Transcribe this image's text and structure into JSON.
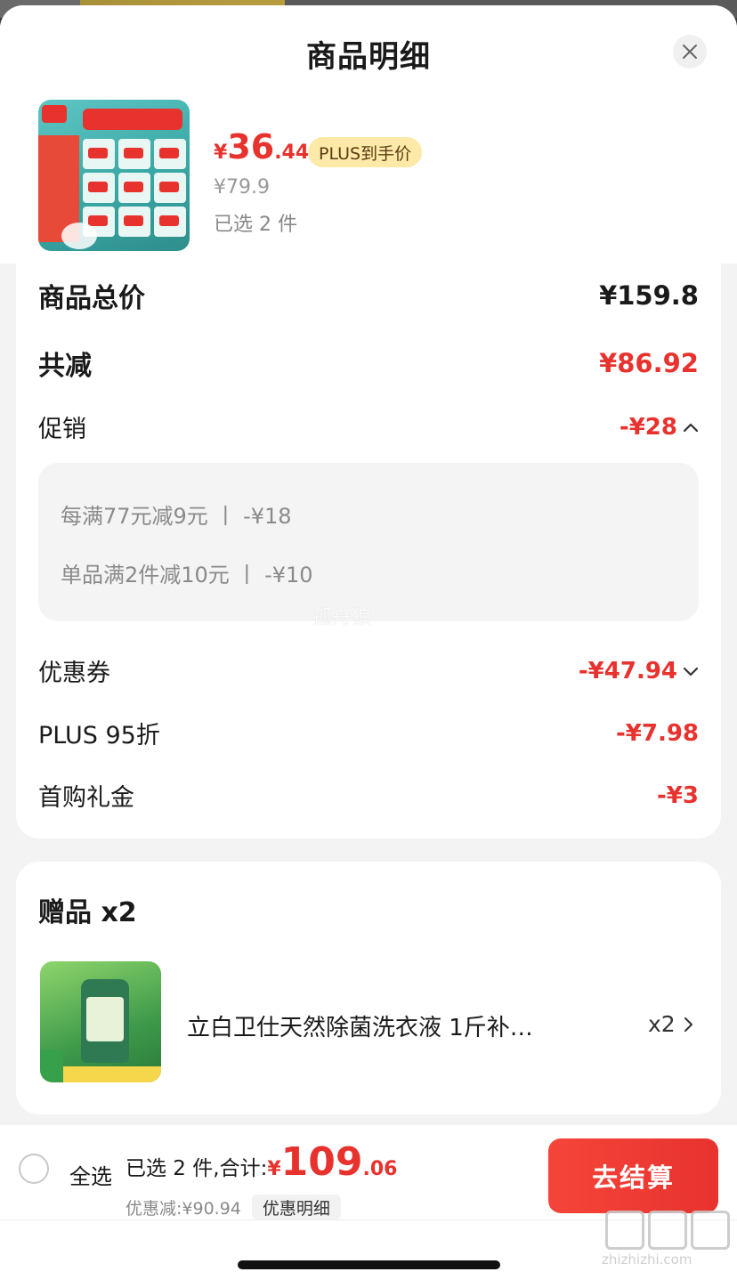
{
  "header": {
    "title": "商品明细",
    "close_icon": "close-icon"
  },
  "product": {
    "price_symbol": "¥",
    "price_int": "36",
    "price_dec": ".44",
    "plus_tag": "PLUS到手价",
    "original_price": "¥79.9",
    "selected": "已选 2 件"
  },
  "breakdown": {
    "total_label": "商品总价",
    "total_value": "¥159.8",
    "reduce_label": "共减",
    "reduce_value": "¥86.92",
    "promo_label": "促销",
    "promo_value": "-¥28",
    "promo_items": [
      "每满77元减9元 丨 -¥18",
      "单品满2件减10元 丨 -¥10"
    ],
    "watermark": "孤舟狼",
    "coupon_label": "优惠券",
    "coupon_value": "-¥47.94",
    "plus_label": "PLUS 95折",
    "plus_value": "-¥7.98",
    "first_label": "首购礼金",
    "first_value": "-¥3"
  },
  "gift": {
    "title": "赠品 x2",
    "name": "立白卫仕天然除菌洗衣液 1斤补…",
    "qty": "x2"
  },
  "bottom": {
    "select_all": "全选",
    "summary_text": "已选 2 件,合计:",
    "total_symbol": "¥",
    "total_int": "109",
    "total_dec": ".06",
    "discount_text": "优惠减:¥90.94",
    "detail_chip": "优惠明细",
    "checkout": "去结算",
    "site": "zhizhizhi.com"
  },
  "colors": {
    "accent": "#e8322e",
    "plus_tag_bg": "#fde9a8"
  }
}
